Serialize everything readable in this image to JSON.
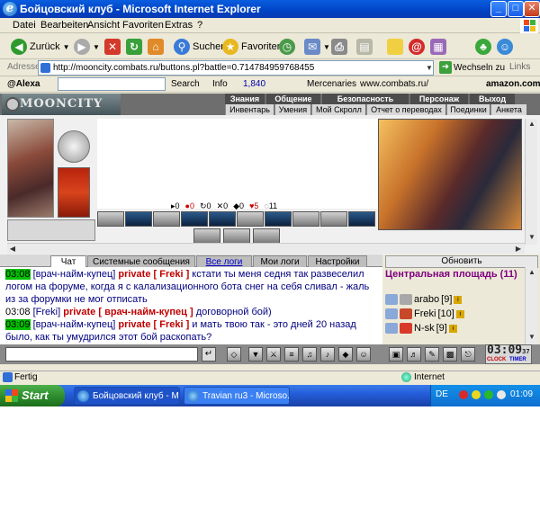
{
  "window": {
    "title": "Бойцовский клуб - Microsoft Internet Explorer",
    "min_label": "_",
    "max_label": "□",
    "close_label": "✕"
  },
  "menu": {
    "items": [
      "Datei",
      "Bearbeiten",
      "Ansicht",
      "Favoriten",
      "Extras",
      "?"
    ]
  },
  "toolbar": {
    "back_label": "Zurück",
    "search_label": "Suchen",
    "favorites_label": "Favoriten"
  },
  "address": {
    "label": "Adresse",
    "url": "http://mooncity.combats.ru/buttons.pl?battle=0.714784959768455",
    "go_label": "Wechseln zu",
    "links_label": "Links"
  },
  "alexa": {
    "brand": "@Alexa",
    "search_label": "Search",
    "info_label": "Info",
    "rank": "1,840",
    "mercenaries": "Mercenaries",
    "site": "www.combats.ru/",
    "amazon": "amazon.com"
  },
  "game": {
    "logo_text": "MOONCITY",
    "top_menu": [
      "Знания",
      "Общение",
      "Безопасность",
      "Персонаж",
      "Выход"
    ],
    "sub_menu": [
      "Инвентарь",
      "Умения",
      "Мой Скролл",
      "Отчет о переводах",
      "Поединки",
      "Анкета"
    ],
    "stats": [
      "0",
      "0",
      "0",
      "0",
      "0",
      "5",
      "11"
    ],
    "chat_tabs": [
      "Чат",
      "Системные сообщения",
      "Все логи",
      "Мои логи",
      "Настройки"
    ],
    "refresh_label": "Обновить",
    "room_title": "Центральная площадь (11)",
    "chat": [
      {
        "time": "03:08",
        "from": "[врач-найм-купец]",
        "priv": "private [ Freki ]",
        "text": "кстати ты меня седня так развеселил логом на форуме, когда я с калализационного бота снег на себя сливал - жаль из за форумки не мог отписать"
      },
      {
        "time": "03:08",
        "from": "[Freki]",
        "priv": "private [ врач-найм-купец ]",
        "text": "договорной бой)"
      },
      {
        "time": "03:09",
        "from": "[врач-найм-купец]",
        "priv": "private [ Freki ]",
        "text": "и мать твою так - это дней 20 назад было, как ты умудрился этот бой раскопать?"
      }
    ],
    "users": [
      {
        "name": "arabo",
        "level": "[9]"
      },
      {
        "name": "Freki",
        "level": "[10]"
      },
      {
        "name": "N-sk",
        "level": "[9]"
      }
    ],
    "clock_time": "03:09",
    "clock_seconds": "37",
    "clock_label": "CLOCK",
    "timer_label": "TIMER"
  },
  "status": {
    "text": "Fertig",
    "zone": "Internet"
  },
  "taskbar": {
    "start_label": "Start",
    "tasks": [
      "Бойцовский клуб - M...",
      "Travian ru3 - Microso..."
    ],
    "language": "DE",
    "time": "01:09"
  }
}
